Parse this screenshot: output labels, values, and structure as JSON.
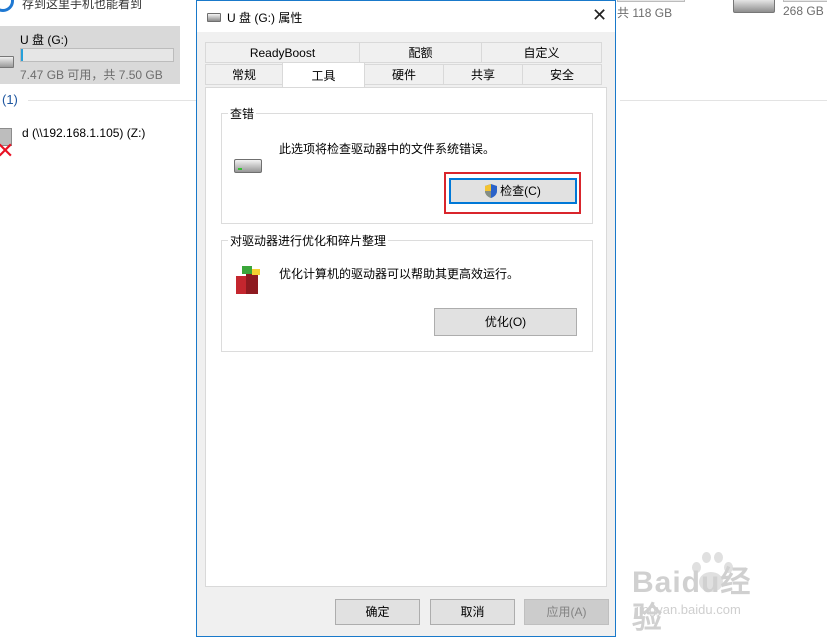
{
  "explorer": {
    "top_text": "存到这里手机也能看到",
    "drive": {
      "name": "U 盘 (G:)",
      "size": "7.47 GB 可用，共 7.50 GB",
      "used_fraction": 0.004
    },
    "section_label": "(1)",
    "network_drive": {
      "name": "d (\\\\192.168.1.105) (Z:)"
    },
    "right_drive_a_size": "共 118 GB",
    "right_drive_b_size": "268 GB"
  },
  "dialog": {
    "title": "U 盘 (G:) 属性",
    "close_symbol": "✕",
    "tabs_row1": [
      "ReadyBoost",
      "配额",
      "自定义"
    ],
    "tabs_row2": [
      "常规",
      "工具",
      "硬件",
      "共享",
      "安全"
    ],
    "active_tab": "工具",
    "error_check": {
      "title": "查错",
      "description": "此选项将检查驱动器中的文件系统错误。",
      "button": "检查(C)"
    },
    "optimize": {
      "title": "对驱动器进行优化和碎片整理",
      "description": "优化计算机的驱动器可以帮助其更高效运行。",
      "button": "优化(O)"
    },
    "footer": {
      "ok": "确定",
      "cancel": "取消",
      "apply": "应用(A)"
    }
  },
  "watermark": {
    "logo": "Baidu经验",
    "url": "jingyan.baidu.com"
  },
  "colors": {
    "dialog_border": "#1979ca",
    "highlight": "#d9252c",
    "focus": "#0078d7",
    "link_blue": "#1e56a0"
  }
}
